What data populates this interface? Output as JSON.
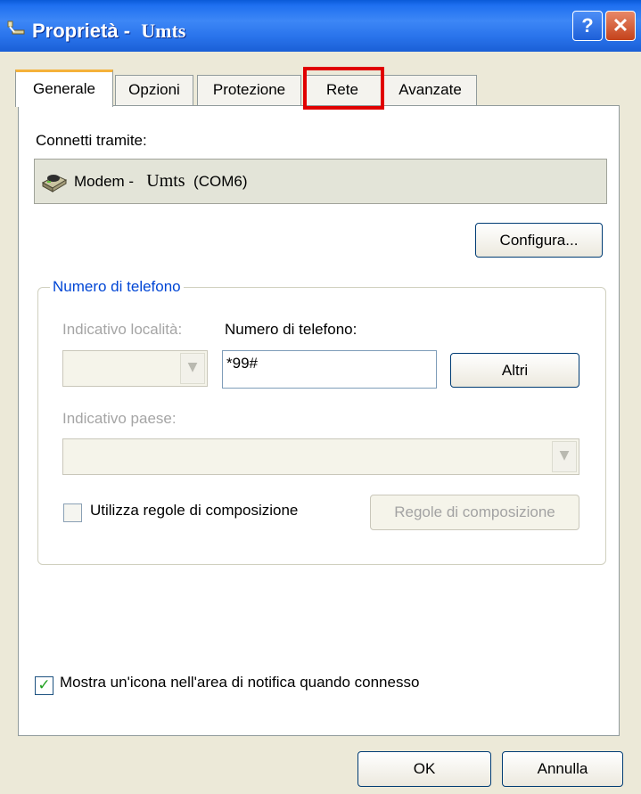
{
  "window": {
    "title_prefix": "Proprietà -",
    "title_name": "Umts",
    "help_glyph": "?",
    "close_glyph": "✕"
  },
  "tabs": [
    {
      "label": "Generale",
      "active": true
    },
    {
      "label": "Opzioni",
      "active": false
    },
    {
      "label": "Protezione",
      "active": false
    },
    {
      "label": "Rete",
      "active": false,
      "highlighted": true
    },
    {
      "label": "Avanzate",
      "active": false
    }
  ],
  "general": {
    "connect_label": "Connetti tramite:",
    "device": {
      "prefix": "Modem -",
      "name": "Umts",
      "port": "(COM6)"
    },
    "configure_button": "Configura...",
    "phone_group": {
      "title": "Numero di telefono",
      "area_code_label": "Indicativo località:",
      "area_code_value": "",
      "phone_number_label": "Numero di telefono:",
      "phone_number_value": "*99#",
      "others_button": "Altri",
      "country_label": "Indicativo paese:",
      "country_value": "",
      "dialing_rules_checkbox": "Utilizza regole di composizione",
      "dialing_rules_checked": false,
      "dialing_rules_button": "Regole di composizione"
    },
    "show_icon_checkbox": "Mostra un'icona nell'area di notifica quando connesso",
    "show_icon_checked": true
  },
  "footer": {
    "ok_button": "OK",
    "cancel_button": "Annulla"
  },
  "colors": {
    "titlebar": "#2a74ec",
    "dialog_bg": "#ECE9D8",
    "group_title": "#0046d5",
    "highlight_box": "#e00000",
    "checkmark": "#21a121"
  }
}
